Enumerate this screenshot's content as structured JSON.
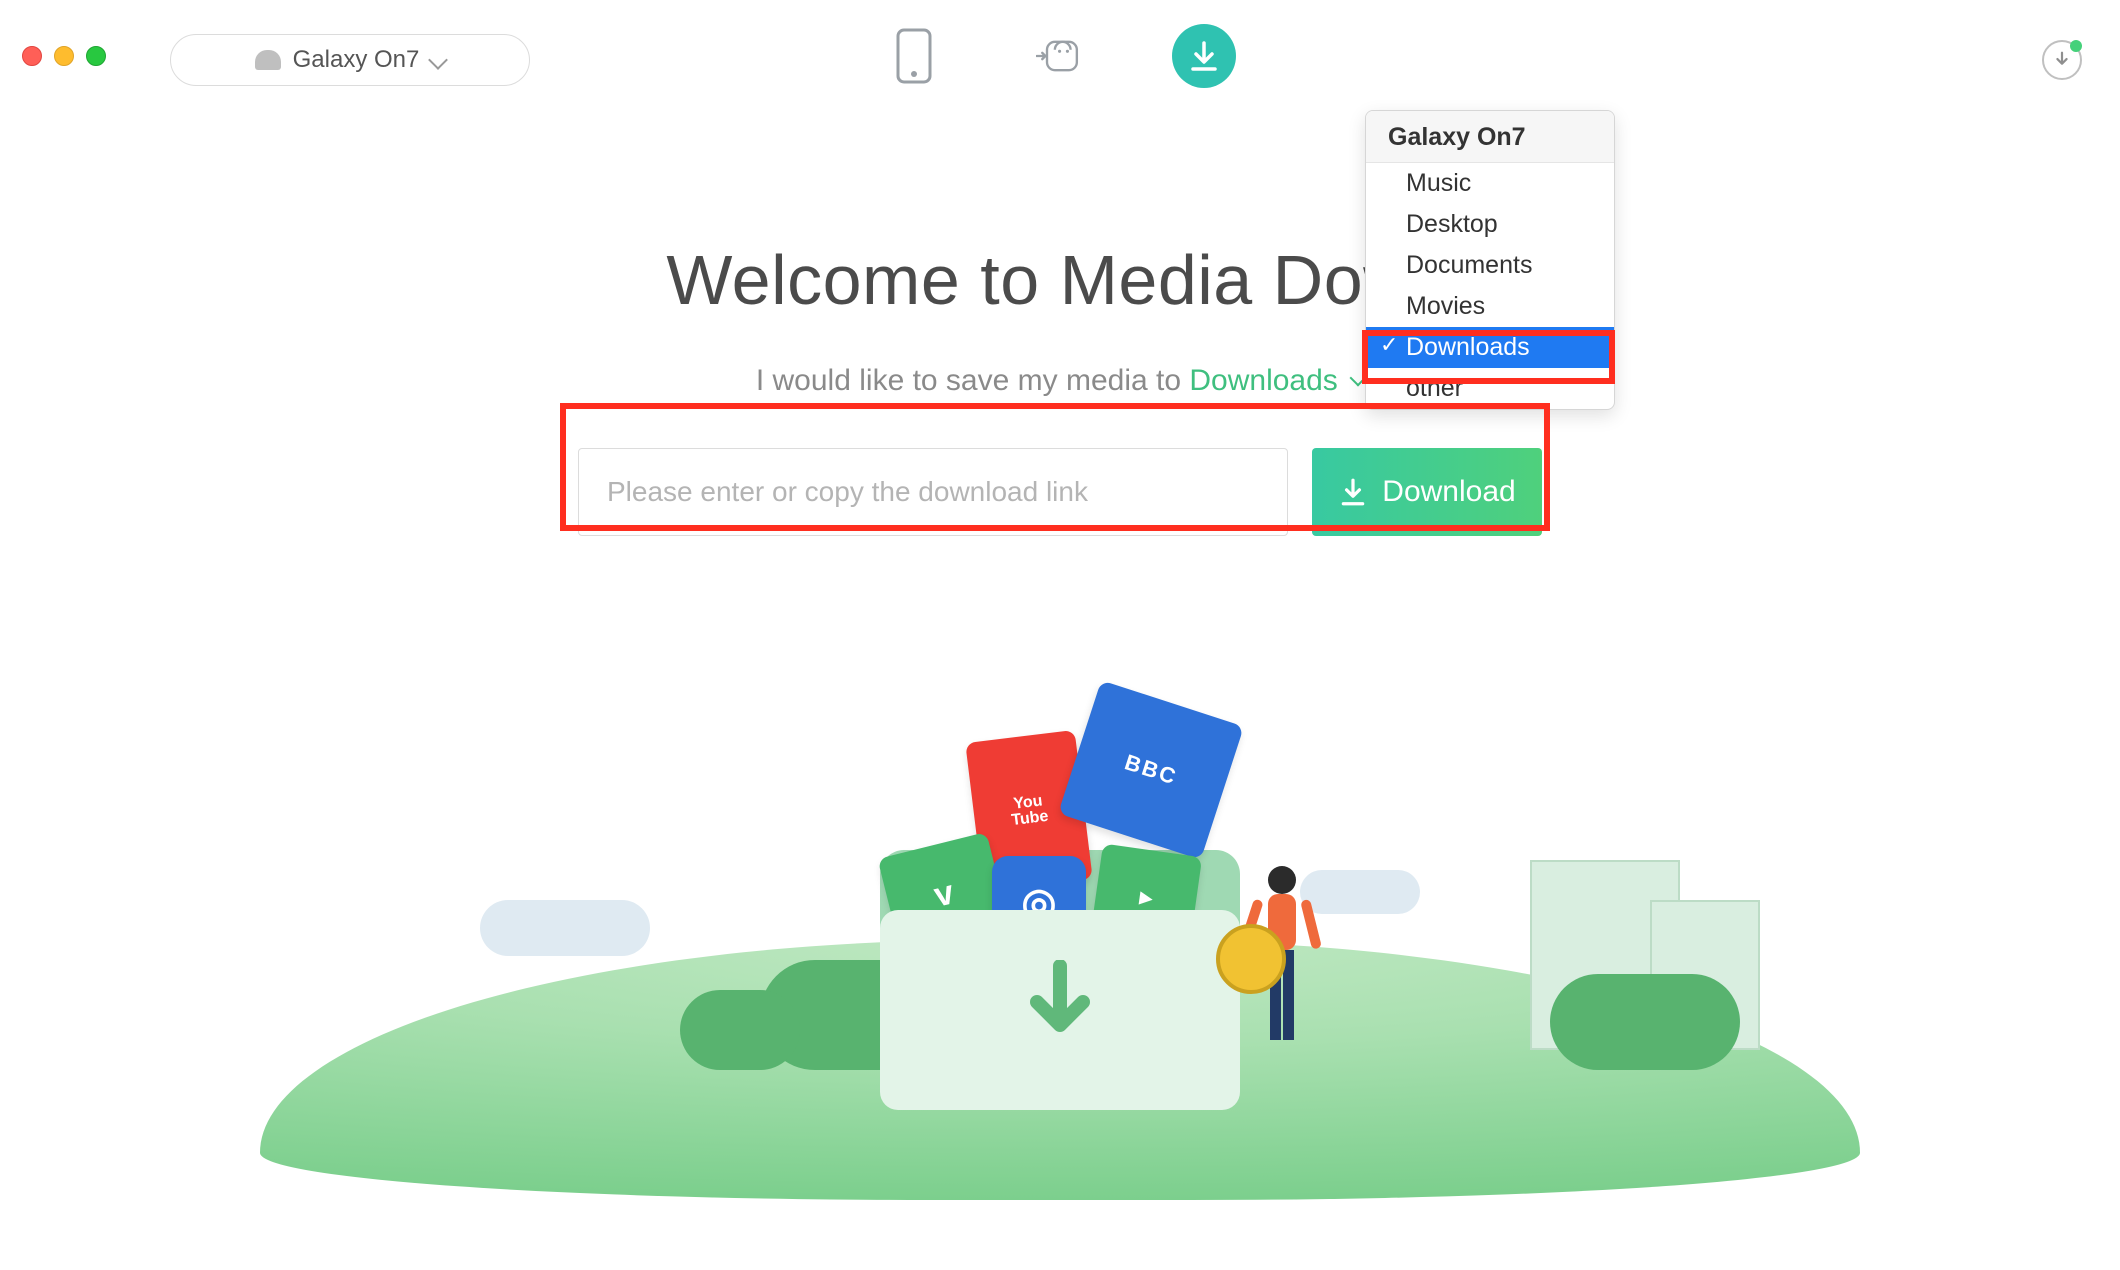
{
  "window": {
    "device_label": "Galaxy On7"
  },
  "nav_icons": {
    "phone": "phone-icon",
    "android_transfer": "android-transfer-icon",
    "download": "download-icon"
  },
  "hero": {
    "title": "Welcome to Media Down",
    "subtitle_prefix": "I would like to save my media to ",
    "destination": "Downloads"
  },
  "input": {
    "placeholder": "Please enter or copy the download link",
    "button_label": "Download"
  },
  "dropdown": {
    "header": "Galaxy On7",
    "items": [
      "Music",
      "Desktop",
      "Documents",
      "Movies",
      "Downloads",
      "other"
    ],
    "selected": "Downloads"
  },
  "illustration_cards": {
    "youtube": "You\nTube",
    "bbc": "BBC",
    "vimeo": "v",
    "instagram": "◎",
    "play": "▶"
  },
  "colors": {
    "accent_teal": "#2fc2b1",
    "accent_green": "#3fbf7f",
    "highlight_red": "#ff2e1f",
    "menu_select_blue": "#1f7af2"
  }
}
